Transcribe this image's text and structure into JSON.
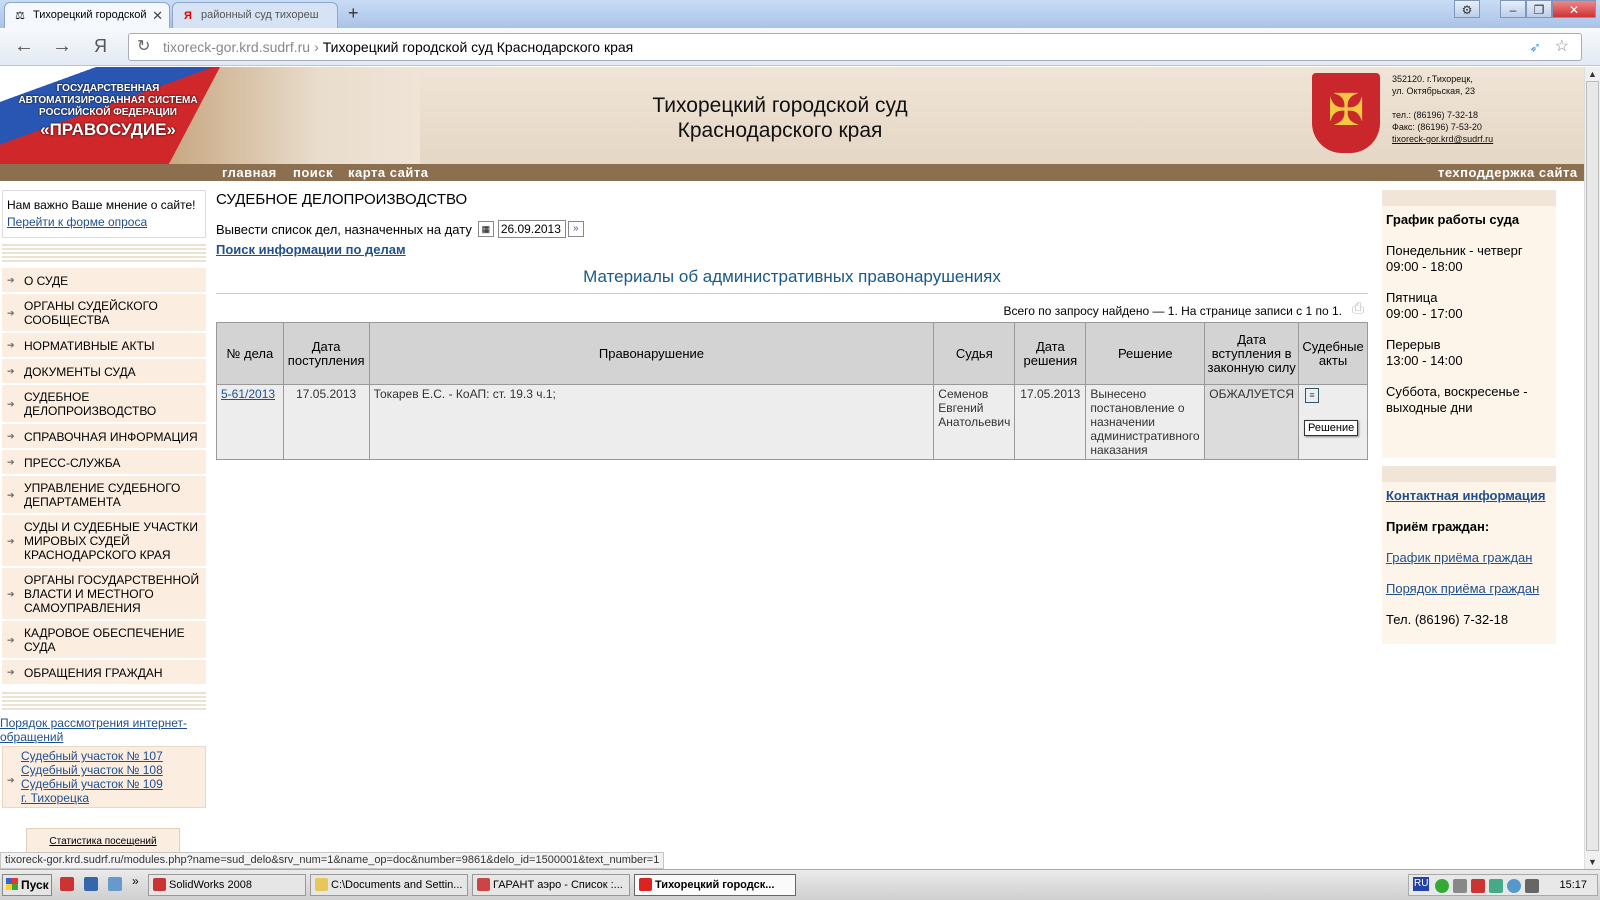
{
  "browser": {
    "tabs": [
      {
        "label": "Тихорецкий городской"
      },
      {
        "label": "районный суд тихореш"
      }
    ],
    "new_tab": "+",
    "window_controls": {
      "minimize": "–",
      "restore": "❐",
      "close": "✕",
      "settings": "⚙"
    },
    "address": {
      "host": "tixoreck-gor.krd.sudrf.ru",
      "separator": "›",
      "title": "Тихорецкий городской суд Краснодарского края"
    },
    "status_url": "tixoreck-gor.krd.sudrf.ru/modules.php?name=sud_delo&srv_num=1&name_op=doc&number=9861&delo_id=1500001&text_number=1"
  },
  "header": {
    "logo": {
      "line1": "ГОСУДАРСТВЕННАЯ",
      "line2": "АВТОМАТИЗИРОВАННАЯ СИСТЕМА",
      "line3": "РОССИЙСКОЙ ФЕДЕРАЦИИ",
      "line4": "«ПРАВОСУДИЕ»"
    },
    "title_line1": "Тихорецкий городской суд",
    "title_line2": "Краснодарского края",
    "address": {
      "line1": "352120. г.Тихорецк,",
      "line2": "ул. Октябрьская, 23",
      "phone": "тел.: (86196) 7-32-18",
      "fax": "Факс: (86196) 7-53-20",
      "email": "tixoreck-gor.krd@sudrf.ru"
    },
    "nav": {
      "home": "главная",
      "search": "поиск",
      "sitemap": "карта сайта",
      "support": "техподдержка сайта"
    }
  },
  "sidebar": {
    "poll_text": "Нам важно Ваше мнение о сайте!",
    "poll_link": "Перейти к форме опроса",
    "items": [
      {
        "label": "О СУДЕ"
      },
      {
        "label": "ОРГАНЫ СУДЕЙСКОГО СООБЩЕСТВА"
      },
      {
        "label": "НОРМАТИВНЫЕ АКТЫ"
      },
      {
        "label": "ДОКУМЕНТЫ СУДА"
      },
      {
        "label": "СУДЕБНОЕ ДЕЛОПРОИЗВОДСТВО"
      },
      {
        "label": "СПРАВОЧНАЯ ИНФОРМАЦИЯ"
      },
      {
        "label": "ПРЕСС-СЛУЖБА"
      },
      {
        "label": "УПРАВЛЕНИЕ СУДЕБНОГО ДЕПАРТАМЕНТА"
      },
      {
        "label": "СУДЫ И СУДЕБНЫЕ УЧАСТКИ МИРОВЫХ СУДЕЙ КРАСНОДАРСКОГО КРАЯ"
      },
      {
        "label": "ОРГАНЫ ГОСУДАРСТВЕННОЙ ВЛАСТИ И МЕСТНОГО САМОУПРАВЛЕНИЯ"
      },
      {
        "label": "КАДРОВОЕ ОБЕСПЕЧЕНИЕ СУДА"
      },
      {
        "label": "ОБРАЩЕНИЯ ГРАЖДАН"
      }
    ],
    "internet_link": "Порядок рассмотрения интернет-обращений",
    "plots": [
      "Судебный участок № 107",
      "Судебный участок № 108",
      "Судебный участок № 109",
      "г. Тихорецка"
    ],
    "stats": "Статистика посещений"
  },
  "main": {
    "section_title": "СУДЕБНОЕ ДЕЛОПРОИЗВОДСТВО",
    "date_label": "Вывести список дел, назначенных на дату",
    "date_value": "26.09.2013",
    "search_link": "Поиск информации по делам",
    "materials_title": "Материалы об административных правонарушениях",
    "found_text": "Всего по запросу найдено — 1. На странице записи с 1 по 1.",
    "table": {
      "headers": [
        "№ дела",
        "Дата поступления",
        "Правонарушение",
        "Судья",
        "Дата решения",
        "Решение",
        "Дата вступления в законную силу",
        "Судебные акты"
      ],
      "rows": [
        {
          "case": "5-61/2013",
          "received": "17.05.2013",
          "offense": "Токарев Е.С. - КоАП: ст. 19.3 ч.1;",
          "judge": "Семенов Евгений Анатольевич",
          "decision_date": "17.05.2013",
          "decision": "Вынесено постановление о назначении административного наказания",
          "effective": "ОБЖАЛУЕТСЯ",
          "acts_tooltip": "Решение"
        }
      ]
    }
  },
  "right": {
    "schedule_title": "График работы суда",
    "mon_thu": "Понедельник - четверг",
    "mon_thu_time": "09:00 - 18:00",
    "fri": "Пятница",
    "fri_time": "09:00 - 17:00",
    "break": "Перерыв",
    "break_time": "13:00 - 14:00",
    "weekend": "Суббота, воскресенье - выходные дни",
    "contact_link": "Контактная информация",
    "reception_title": "Приём граждан:",
    "reception_schedule": "График приёма граждан",
    "reception_order": "Порядок приёма граждан",
    "phone": "Тел. (86196) 7-32-18"
  },
  "taskbar": {
    "start": "Пуск",
    "items": [
      {
        "label": "SolidWorks 2008"
      },
      {
        "label": "C:\\Documents and Settin..."
      },
      {
        "label": "ГАРАНТ аэро - Список :..."
      },
      {
        "label": "Тихорецкий городск..."
      }
    ],
    "lang": "RU",
    "clock": "15:17"
  }
}
